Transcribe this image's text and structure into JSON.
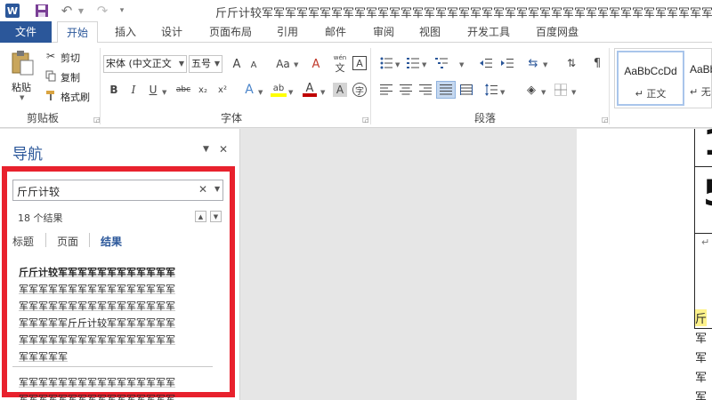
{
  "app": {
    "document_title": "斤斤计较军军军军军军军军军军军军军军军军军军军军军军军军军军军军军军军军军军军军军军军"
  },
  "quick_access": {
    "app_icon": "word-logo-icon",
    "app_letter": "W",
    "undo_icon": "↶",
    "redo_icon": "↷"
  },
  "tabs": [
    {
      "label": "文件"
    },
    {
      "label": "开始"
    },
    {
      "label": "插入"
    },
    {
      "label": "设计"
    },
    {
      "label": "页面布局"
    },
    {
      "label": "引用"
    },
    {
      "label": "邮件"
    },
    {
      "label": "审阅"
    },
    {
      "label": "视图"
    },
    {
      "label": "开发工具"
    },
    {
      "label": "百度网盘"
    }
  ],
  "ribbon": {
    "clipboard": {
      "group_label": "剪贴板",
      "paste_label": "粘贴",
      "cut_label": "剪切",
      "copy_label": "复制",
      "format_painter_label": "格式刷"
    },
    "font": {
      "group_label": "字体",
      "font_name": "宋体 (中文正文",
      "font_size": "五号",
      "grow_icon": "A",
      "shrink_icon": "A",
      "case_icon": "Aa",
      "clear_format_icon": "A",
      "phonetic_top": "wén",
      "phonetic_char": "文",
      "border_char": "A",
      "bold": "B",
      "italic": "I",
      "underline": "U",
      "strike": "abc",
      "subscript": "x₂",
      "superscript": "x²",
      "text_effect": "A",
      "highlight": "ab",
      "font_color": "A",
      "char_shading": "A",
      "enclose_char": "字"
    },
    "paragraph": {
      "group_label": "段落"
    },
    "styles": {
      "normal_sample": "AaBbCcDd",
      "normal_label": "正文",
      "nospace_sample": "AaBbCcDd",
      "nospace_label": "无"
    }
  },
  "nav": {
    "title": "导航",
    "search_value": "斤斤计较",
    "result_count": "18 个结果",
    "tabs": [
      {
        "label": "标题"
      },
      {
        "label": "页面"
      },
      {
        "label": "结果"
      }
    ],
    "result1_lines": [
      "斤斤计较军军军军军军军军军军军军",
      "军军军军军军军军军军军军军军军军",
      "军军军军军军军军军军军军军军军军",
      "军军军军军斤斤计较军军军军军军军",
      "军军军军军军军军军军军军军军军军",
      "军军军军军"
    ],
    "result2_first": "军军军军军军军军军军军军军军军军",
    "result2_second": "军军军军军军军军军军军军军军军军"
  },
  "document": {
    "glyph_top": "1",
    "glyph_mid": "5",
    "return_mark": "↵",
    "lines": [
      "斤",
      "军",
      "军",
      "军",
      "军"
    ]
  },
  "colors": {
    "accent": "#2b579a",
    "highlight_box": "#e8212d",
    "search_highlight": "#fdf28b"
  }
}
